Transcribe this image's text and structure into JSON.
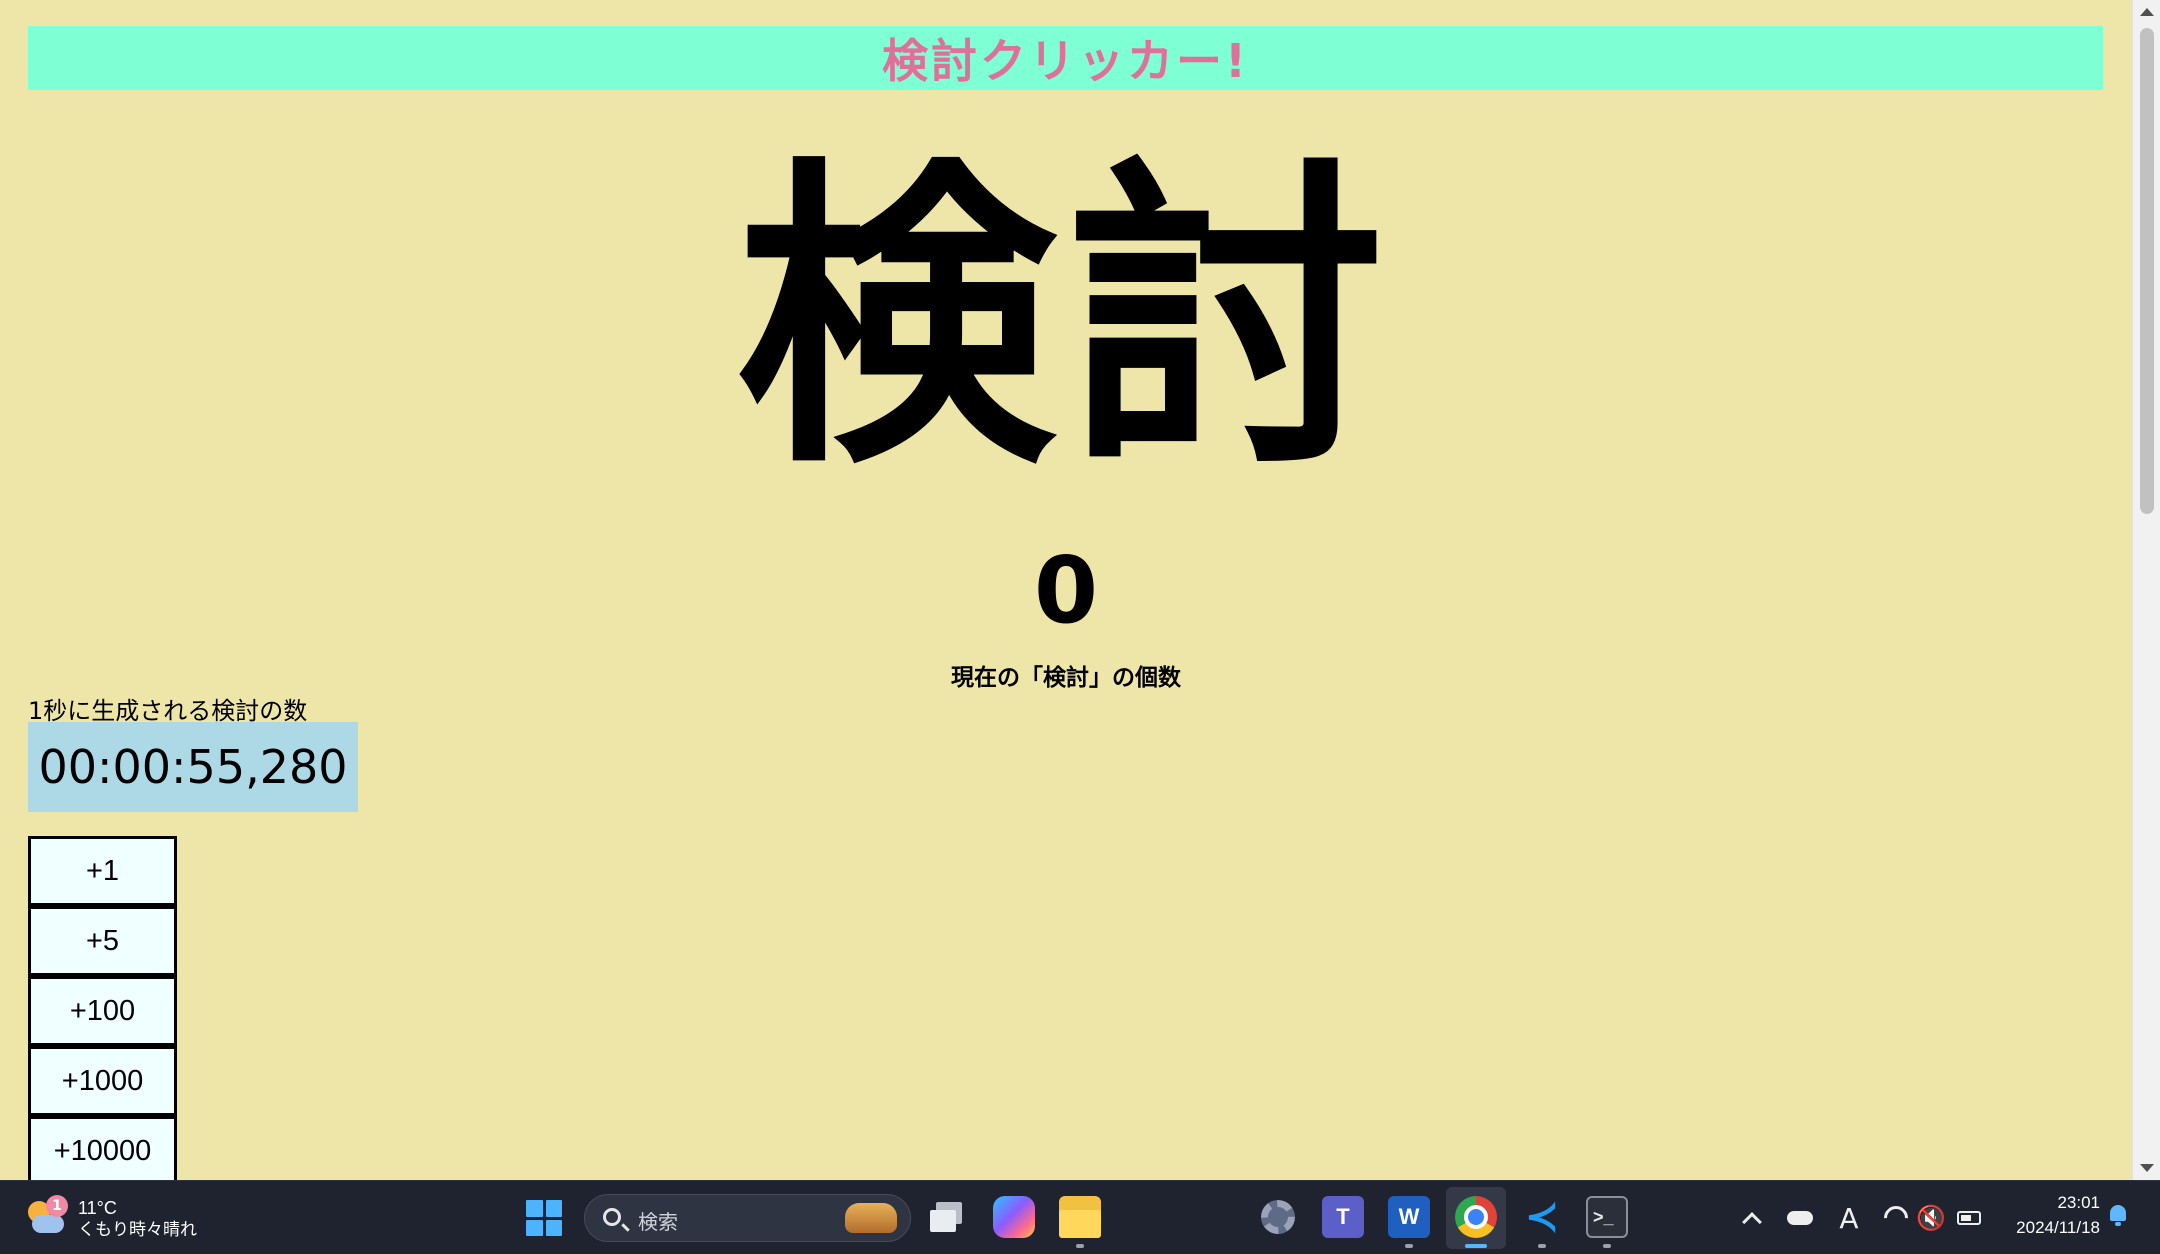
{
  "header": {
    "title": "検討クリッカー!"
  },
  "main": {
    "big_label": "検討",
    "count": "0",
    "count_label": "現在の「検討」の個数"
  },
  "rate": {
    "label": "1秒に生成される検討の数",
    "timer": "00:00:55,280"
  },
  "buttons": [
    {
      "label": "+1"
    },
    {
      "label": "+5"
    },
    {
      "label": "+100"
    },
    {
      "label": "+1000"
    },
    {
      "label": "+10000"
    }
  ],
  "colors": {
    "page_background": "#eee6a9",
    "title_bar": "#7fffd4",
    "title_text": "#e0709a",
    "timer_box": "#add8e6",
    "button_background": "#f0ffff"
  },
  "taskbar": {
    "weather": {
      "badge": "1",
      "temperature": "11°C",
      "description": "くもり時々晴れ",
      "icon": "partly-cloudy-icon"
    },
    "search_placeholder": "検索",
    "apps": [
      {
        "name": "start-icon"
      },
      {
        "name": "task-view-icon"
      },
      {
        "name": "copilot-icon"
      },
      {
        "name": "file-explorer-icon"
      },
      {
        "name": "settings-icon"
      },
      {
        "name": "teams-icon",
        "glyph": "T"
      },
      {
        "name": "word-icon",
        "glyph": "W"
      },
      {
        "name": "chrome-icon"
      },
      {
        "name": "vscode-icon",
        "glyph": "≺"
      },
      {
        "name": "terminal-icon",
        "glyph": ">_"
      }
    ],
    "tray": {
      "ime": "A",
      "volume": "🔇"
    },
    "clock": {
      "time": "23:01",
      "date": "2024/11/18"
    }
  }
}
